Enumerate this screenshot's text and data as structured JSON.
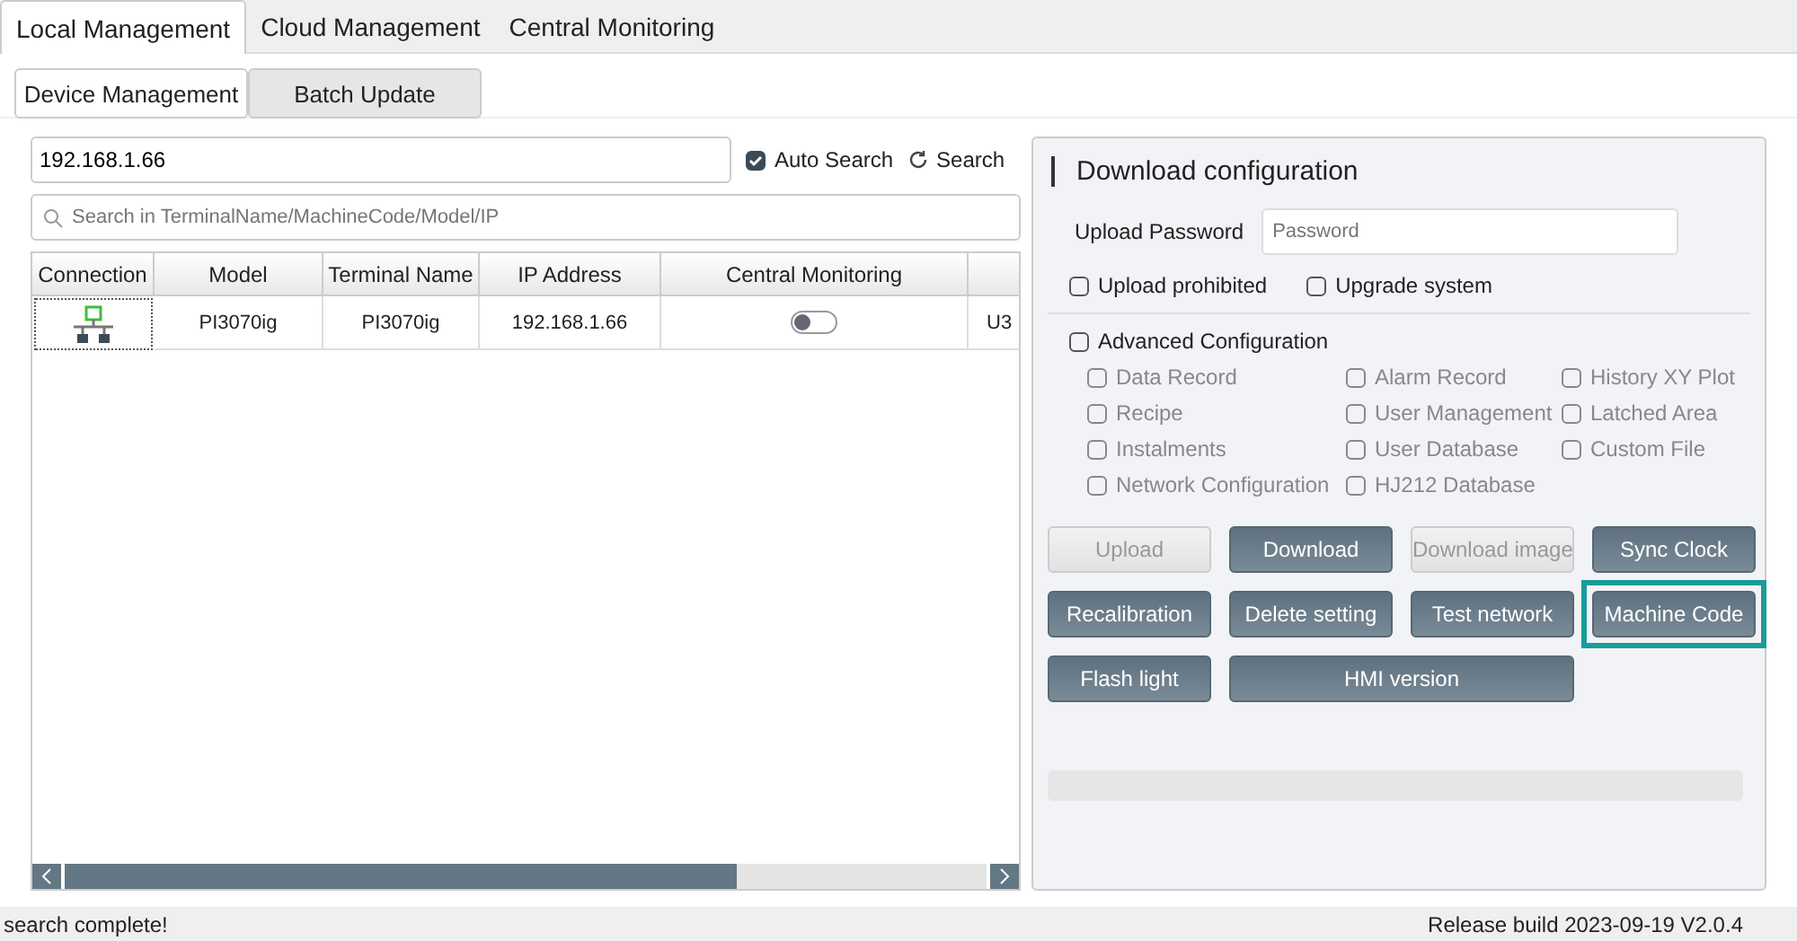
{
  "tabs": [
    {
      "label": "Local Management",
      "selected": true
    },
    {
      "label": "Cloud Management",
      "selected": false
    },
    {
      "label": "Central Monitoring",
      "selected": false
    }
  ],
  "subtabs": [
    {
      "label": "Device Management",
      "selected": true
    },
    {
      "label": "Batch Update",
      "selected": false
    }
  ],
  "address_field": {
    "value": "192.168.1.66"
  },
  "auto_search": {
    "label": "Auto Search",
    "checked": true
  },
  "search_button": {
    "label": "Search"
  },
  "filter_field": {
    "placeholder": "Search in TerminalName/MachineCode/Model/IP"
  },
  "table": {
    "columns": [
      "Connection",
      "Model",
      "Terminal Name",
      "IP Address",
      "Central Monitoring",
      ""
    ],
    "rows": [
      {
        "connected": true,
        "model": "PI3070ig",
        "terminal_name": "PI3070ig",
        "ip_address": "192.168.1.66",
        "central_monitoring": false,
        "column_6": "U3"
      }
    ]
  },
  "config": {
    "title": "Download configuration",
    "password_label": "Upload Password",
    "password_placeholder": "Password",
    "options": [
      {
        "label": "Upload prohibited",
        "checked": false
      },
      {
        "label": "Upgrade system",
        "checked": false
      }
    ],
    "advanced": {
      "label": "Advanced Configuration",
      "checked": false
    },
    "advanced_items": [
      {
        "label": "Data Record",
        "checked": false,
        "disabled": true
      },
      {
        "label": "Alarm Record",
        "checked": false,
        "disabled": true
      },
      {
        "label": "History XY Plot",
        "checked": false,
        "disabled": true
      },
      {
        "label": "Recipe",
        "checked": false,
        "disabled": true
      },
      {
        "label": "User Management",
        "checked": false,
        "disabled": true
      },
      {
        "label": "Latched Area",
        "checked": false,
        "disabled": true
      },
      {
        "label": "Instalments",
        "checked": false,
        "disabled": true
      },
      {
        "label": "User Database",
        "checked": false,
        "disabled": true
      },
      {
        "label": "Custom File",
        "checked": false,
        "disabled": true
      },
      {
        "label": "Network Configuration",
        "checked": false,
        "disabled": true
      },
      {
        "label": "HJ212 Database",
        "checked": false,
        "disabled": true
      }
    ],
    "buttons": [
      {
        "label": "Upload",
        "disabled": true,
        "highlighted": false,
        "wide": false
      },
      {
        "label": "Download",
        "disabled": false,
        "highlighted": false,
        "wide": false
      },
      {
        "label": "Download image",
        "disabled": true,
        "highlighted": false,
        "wide": false
      },
      {
        "label": "Sync Clock",
        "disabled": false,
        "highlighted": false,
        "wide": false
      },
      {
        "label": "Recalibration",
        "disabled": false,
        "highlighted": false,
        "wide": false
      },
      {
        "label": "Delete setting",
        "disabled": false,
        "highlighted": false,
        "wide": false
      },
      {
        "label": "Test network",
        "disabled": false,
        "highlighted": false,
        "wide": false
      },
      {
        "label": "Machine Code",
        "disabled": false,
        "highlighted": true,
        "wide": false
      },
      {
        "label": "Flash light",
        "disabled": false,
        "highlighted": false,
        "wide": false
      },
      {
        "label": "HMI version",
        "disabled": false,
        "highlighted": false,
        "wide": true
      }
    ],
    "progress": {
      "level": 0
    }
  },
  "status_bar": {
    "message": "search complete!",
    "version": "Release build 2023-09-19 V2.0.4"
  }
}
